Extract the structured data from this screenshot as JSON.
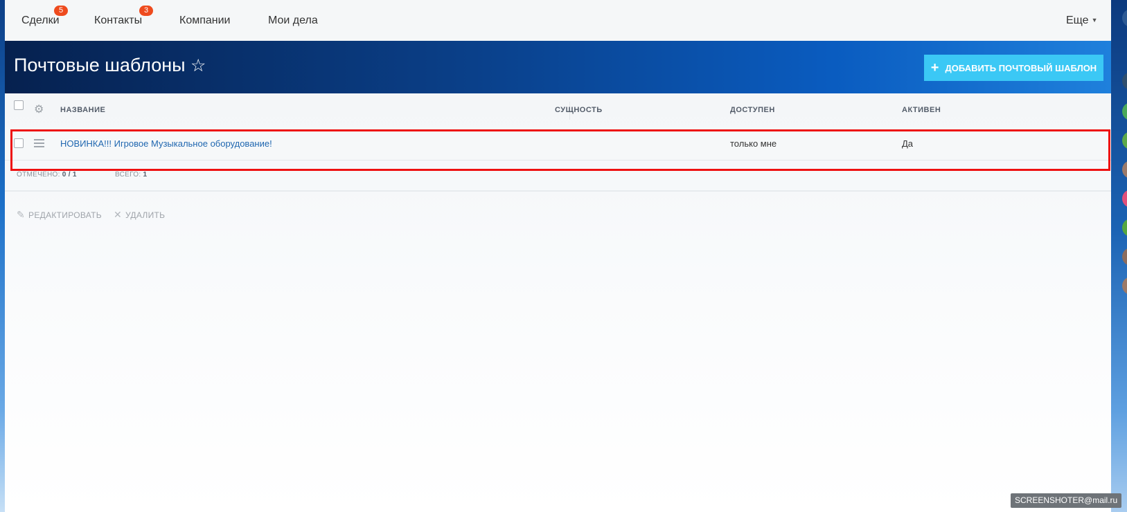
{
  "nav": {
    "items": [
      {
        "label": "Сделки",
        "badge": "5"
      },
      {
        "label": "Контакты",
        "badge": "3"
      },
      {
        "label": "Компании"
      },
      {
        "label": "Мои дела"
      }
    ],
    "more_label": "Еще"
  },
  "header": {
    "title": "Почтовые шаблоны",
    "add_button_label": "ДОБАВИТЬ ПОЧТОВЫЙ ШАБЛОН"
  },
  "table": {
    "columns": [
      "НАЗВАНИЕ",
      "СУЩНОСТЬ",
      "ДОСТУПЕН",
      "АКТИВЕН"
    ],
    "rows": [
      {
        "name": "НОВИНКА!!! Игровое Музыкальное оборудование!",
        "entity": "",
        "available": "только мне",
        "active": "Да"
      }
    ],
    "footer": {
      "selected_label": "ОТМЕЧЕНО:",
      "selected_value": "0 / 1",
      "total_label": "ВСЕГО:",
      "total_value": "1"
    }
  },
  "actions": {
    "edit_label": "РЕДАКТИРОВАТЬ",
    "delete_label": "УДАЛИТЬ"
  },
  "watermark": "SCREENSHOTER@mail.ru",
  "colors": {
    "accent": "#3bc8f5",
    "badge": "#ee4b1e",
    "link": "#2067b0",
    "highlight": "#ee1111"
  }
}
